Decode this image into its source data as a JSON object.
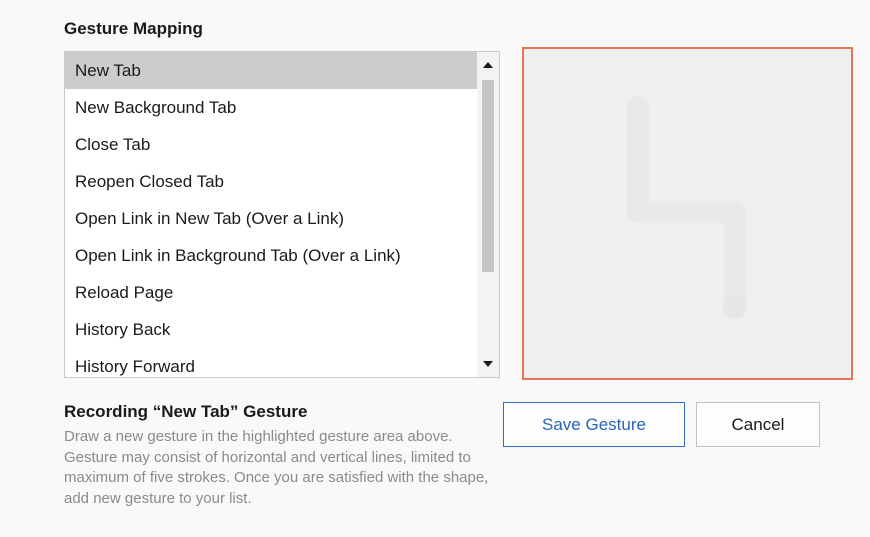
{
  "section": {
    "title": "Gesture Mapping"
  },
  "gesture_list": {
    "items": [
      {
        "label": "New Tab",
        "selected": true
      },
      {
        "label": "New Background Tab",
        "selected": false
      },
      {
        "label": "Close Tab",
        "selected": false
      },
      {
        "label": "Reopen Closed Tab",
        "selected": false
      },
      {
        "label": "Open Link in New Tab (Over a Link)",
        "selected": false
      },
      {
        "label": "Open Link in Background Tab (Over a Link)",
        "selected": false
      },
      {
        "label": "Reload Page",
        "selected": false
      },
      {
        "label": "History Back",
        "selected": false
      },
      {
        "label": "History Forward",
        "selected": false
      }
    ],
    "scroll_up_icon": "chevron-up-icon",
    "scroll_down_icon": "chevron-down-icon"
  },
  "gesture_area": {
    "border_color": "#e5735b",
    "background_color": "#efeff0",
    "stroke_color": "#e9e9ea"
  },
  "recording": {
    "title": "Recording “New Tab” Gesture",
    "description": "Draw a new gesture in the highlighted gesture area above. Gesture may consist of horizontal and vertical lines, limited to maximum of five strokes. Once you are satisfied with the shape, add new gesture to your list."
  },
  "buttons": {
    "save_label": "Save Gesture",
    "cancel_label": "Cancel",
    "accent_color": "#2966b5"
  }
}
